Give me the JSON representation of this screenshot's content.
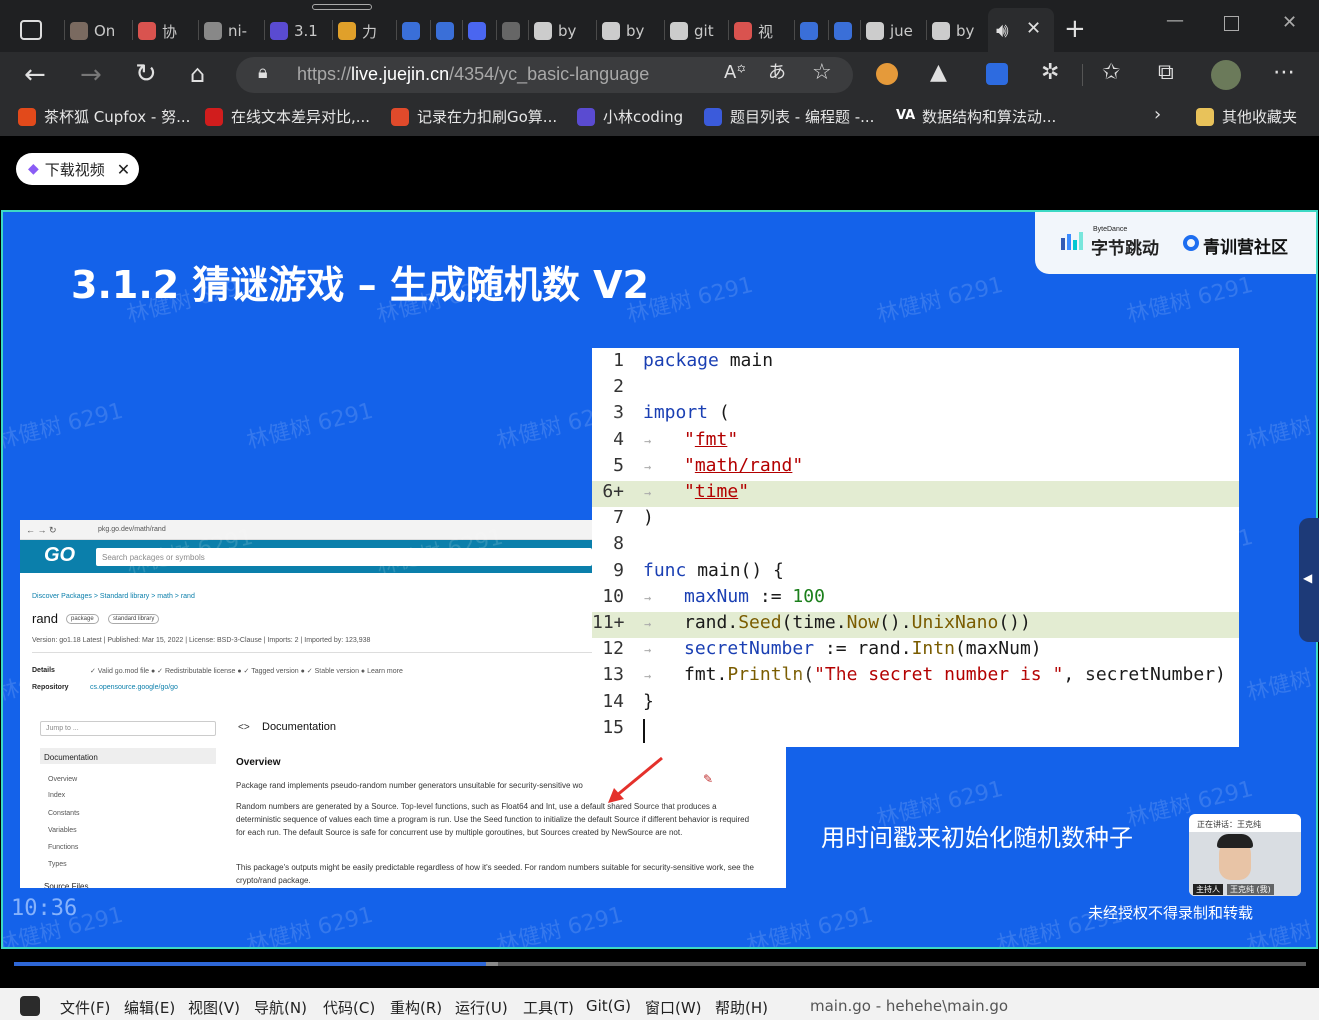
{
  "browser": {
    "tabs": [
      {
        "label": "On",
        "color": "#7a6a60"
      },
      {
        "label": "协",
        "color": "#d9534f"
      },
      {
        "label": "ni-",
        "color": "#888888"
      },
      {
        "label": "3.1",
        "color": "#5a4bd1"
      },
      {
        "label": "力",
        "color": "#e0a02a"
      },
      {
        "label": "",
        "color": "#3a6fd8"
      },
      {
        "label": "【(",
        "color": "#3a6fd8"
      },
      {
        "label": "",
        "color": "#4a66f0"
      },
      {
        "label": "【",
        "color": "#666666"
      },
      {
        "label": "by",
        "color": "#cccccc"
      },
      {
        "label": "by",
        "color": "#cccccc"
      },
      {
        "label": "git",
        "color": "#cccccc"
      },
      {
        "label": "视",
        "color": "#d9534f"
      },
      {
        "label": "",
        "color": "#3a6fd8"
      },
      {
        "label": "",
        "color": "#3a6fd8"
      },
      {
        "label": "jue",
        "color": "#cccccc"
      },
      {
        "label": "by",
        "color": "#cccccc"
      }
    ],
    "url_prefix": "https://",
    "url_domain": "live.juejin.cn",
    "url_path": "/4354/yc_basic-language",
    "bookmarks": [
      {
        "label": "茶杯狐 Cupfox - 努...",
        "color": "#e24a1b"
      },
      {
        "label": "在线文本差异对比,...",
        "color": "#d11d1d"
      },
      {
        "label": "记录在力扣刷Go算...",
        "color": "#e04a2b"
      },
      {
        "label": "小林coding",
        "color": "#5a4bd1"
      },
      {
        "label": "题目列表 - 编程题 -...",
        "color": "#3b5bdb"
      },
      {
        "label": "数据结构和算法动...",
        "color": "#ffffff"
      }
    ],
    "other_bookmarks": "其他收藏夹"
  },
  "video": {
    "download_chip": "下载视频",
    "watermark": "林健树 6291",
    "timecode": "10:36",
    "progress": 0.365
  },
  "slide": {
    "title": "3.1.2 猜谜游戏 – 生成随机数 V2",
    "brand_en": "ByteDance",
    "brand_cn": "字节跳动",
    "brand_community": "青训营社区",
    "subtitle": "用时间戳来初始化随机数种子",
    "copyright": "未经授权不得录制和转载",
    "speaker_label": "正在讲话：王克纯",
    "host_label": "主持人",
    "host_name": "王克纯 (我)",
    "code": [
      {
        "n": "1",
        "text": "package main"
      },
      {
        "n": "2",
        "text": ""
      },
      {
        "n": "3",
        "text": "import ("
      },
      {
        "n": "4",
        "text": "\"fmt\""
      },
      {
        "n": "5",
        "text": "\"math/rand\""
      },
      {
        "n": "6+",
        "text": "\"time\""
      },
      {
        "n": "7",
        "text": ")"
      },
      {
        "n": "8",
        "text": ""
      },
      {
        "n": "9",
        "text": "func main() {"
      },
      {
        "n": "10",
        "text": "maxNum := 100"
      },
      {
        "n": "11+",
        "text": "rand.Seed(time.Now().UnixNano())"
      },
      {
        "n": "12",
        "text": "secretNumber := rand.Intn(maxNum)"
      },
      {
        "n": "13",
        "text": "fmt.Println(\"The secret number is \", secretNumber)"
      },
      {
        "n": "14",
        "text": "}"
      },
      {
        "n": "15",
        "text": ""
      }
    ],
    "doc": {
      "address": "pkg.go.dev/math/rand",
      "search_placeholder": "Search packages or symbols",
      "breadcrumb": "Discover Packages  >  Standard library  >  math  >  rand",
      "pkg_name": "rand",
      "tag_package": "package",
      "tag_stdlib": "standard library",
      "meta": "Version: go1.18   Latest   |   Published: Mar 15, 2022   |   License: BSD-3-Clause   |   Imports: 2   |   Imported by: 123,938",
      "details_label": "Details",
      "details_items": "✓ Valid go.mod file ●     ✓ Redistributable license ●     ✓ Tagged version ●     ✓ Stable version ●     Learn more",
      "repository_label": "Repository",
      "repository_value": "cs.opensource.google/go/go",
      "jump_placeholder": "Jump to ...",
      "nav": [
        "Documentation",
        "Overview",
        "Index",
        "Constants",
        "Variables",
        "Functions",
        "Types",
        "Source Files"
      ],
      "doc_heading": "Documentation",
      "overview_heading": "Overview",
      "para1": "Package rand implements pseudo-random number generators unsuitable for security-sensitive wo",
      "para2": "Random numbers are generated by a Source. Top-level functions, such as Float64 and Int, use a default shared Source that produces a deterministic sequence of values each time a program is run. Use the Seed function to initialize the default Source if different behavior is required for each run. The default Source is safe for concurrent use by multiple goroutines, but Sources created by NewSource are not.",
      "para3": "This package's outputs might be easily predictable regardless of how it's seeded. For random numbers suitable for security-sensitive work, see the crypto/rand package."
    }
  },
  "ide": {
    "menus": [
      "文件(F)",
      "编辑(E)",
      "视图(V)",
      "导航(N)",
      "代码(C)",
      "重构(R)",
      "运行(U)",
      "工具(T)",
      "Git(G)",
      "窗口(W)",
      "帮助(H)"
    ],
    "title": "main.go - hehehe\\main.go"
  }
}
